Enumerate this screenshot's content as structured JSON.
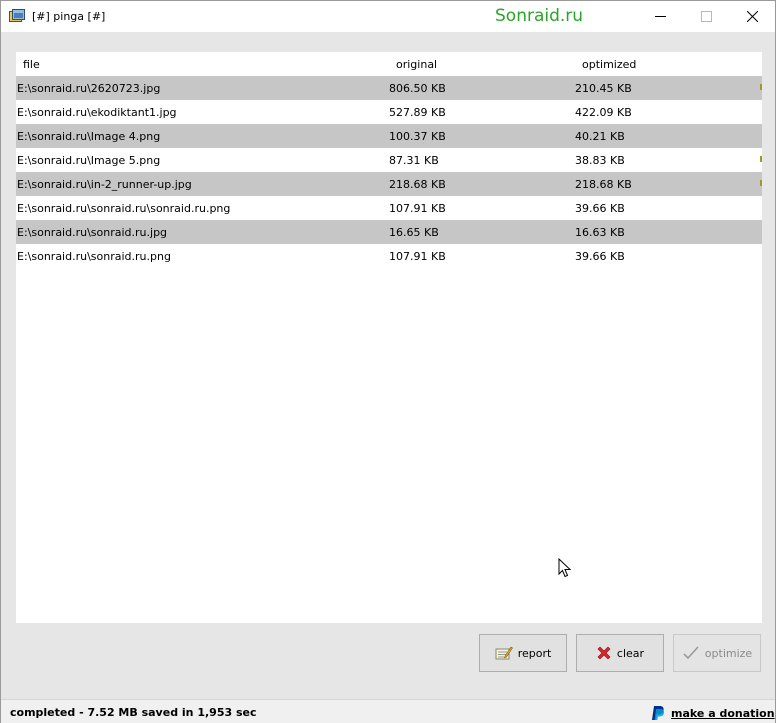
{
  "window": {
    "title": "[#] pinga [#]",
    "watermark": "Sonraid.ru",
    "controls": {
      "minimize": "—",
      "maximize": "☐",
      "close": "✕"
    }
  },
  "list": {
    "columns": {
      "file": "file",
      "original": "original",
      "optimized": "optimized"
    },
    "rows": [
      {
        "file": "E:\\sonraid.ru\\2620723.jpg",
        "original": "806.50 KB",
        "optimized": "210.45 KB"
      },
      {
        "file": "E:\\sonraid.ru\\ekodiktant1.jpg",
        "original": "527.89 KB",
        "optimized": "422.09 KB"
      },
      {
        "file": "E:\\sonraid.ru\\Image 4.png",
        "original": "100.37 KB",
        "optimized": "40.21 KB"
      },
      {
        "file": "E:\\sonraid.ru\\Image 5.png",
        "original": "87.31 KB",
        "optimized": "38.83 KB"
      },
      {
        "file": "E:\\sonraid.ru\\in-2_runner-up.jpg",
        "original": "218.68 KB",
        "optimized": "218.68 KB"
      },
      {
        "file": "E:\\sonraid.ru\\sonraid.ru\\sonraid.ru.png",
        "original": "107.91 KB",
        "optimized": "39.66 KB"
      },
      {
        "file": "E:\\sonraid.ru\\sonraid.ru.jpg",
        "original": "16.65 KB",
        "optimized": "16.63 KB"
      },
      {
        "file": "E:\\sonraid.ru\\sonraid.ru.png",
        "original": "107.91 KB",
        "optimized": "39.66 KB"
      }
    ]
  },
  "buttons": {
    "report": "report",
    "clear": "clear",
    "optimize": "optimize"
  },
  "status": {
    "text": "completed -  7.52 MB saved in 1,953 sec",
    "donate": "make a donation"
  },
  "colors": {
    "row_shaded": "#c6c6c6",
    "watermark": "#2aa52a",
    "paypal_dark": "#003087",
    "paypal_light": "#009cde",
    "clear_icon": "#d9262b"
  }
}
